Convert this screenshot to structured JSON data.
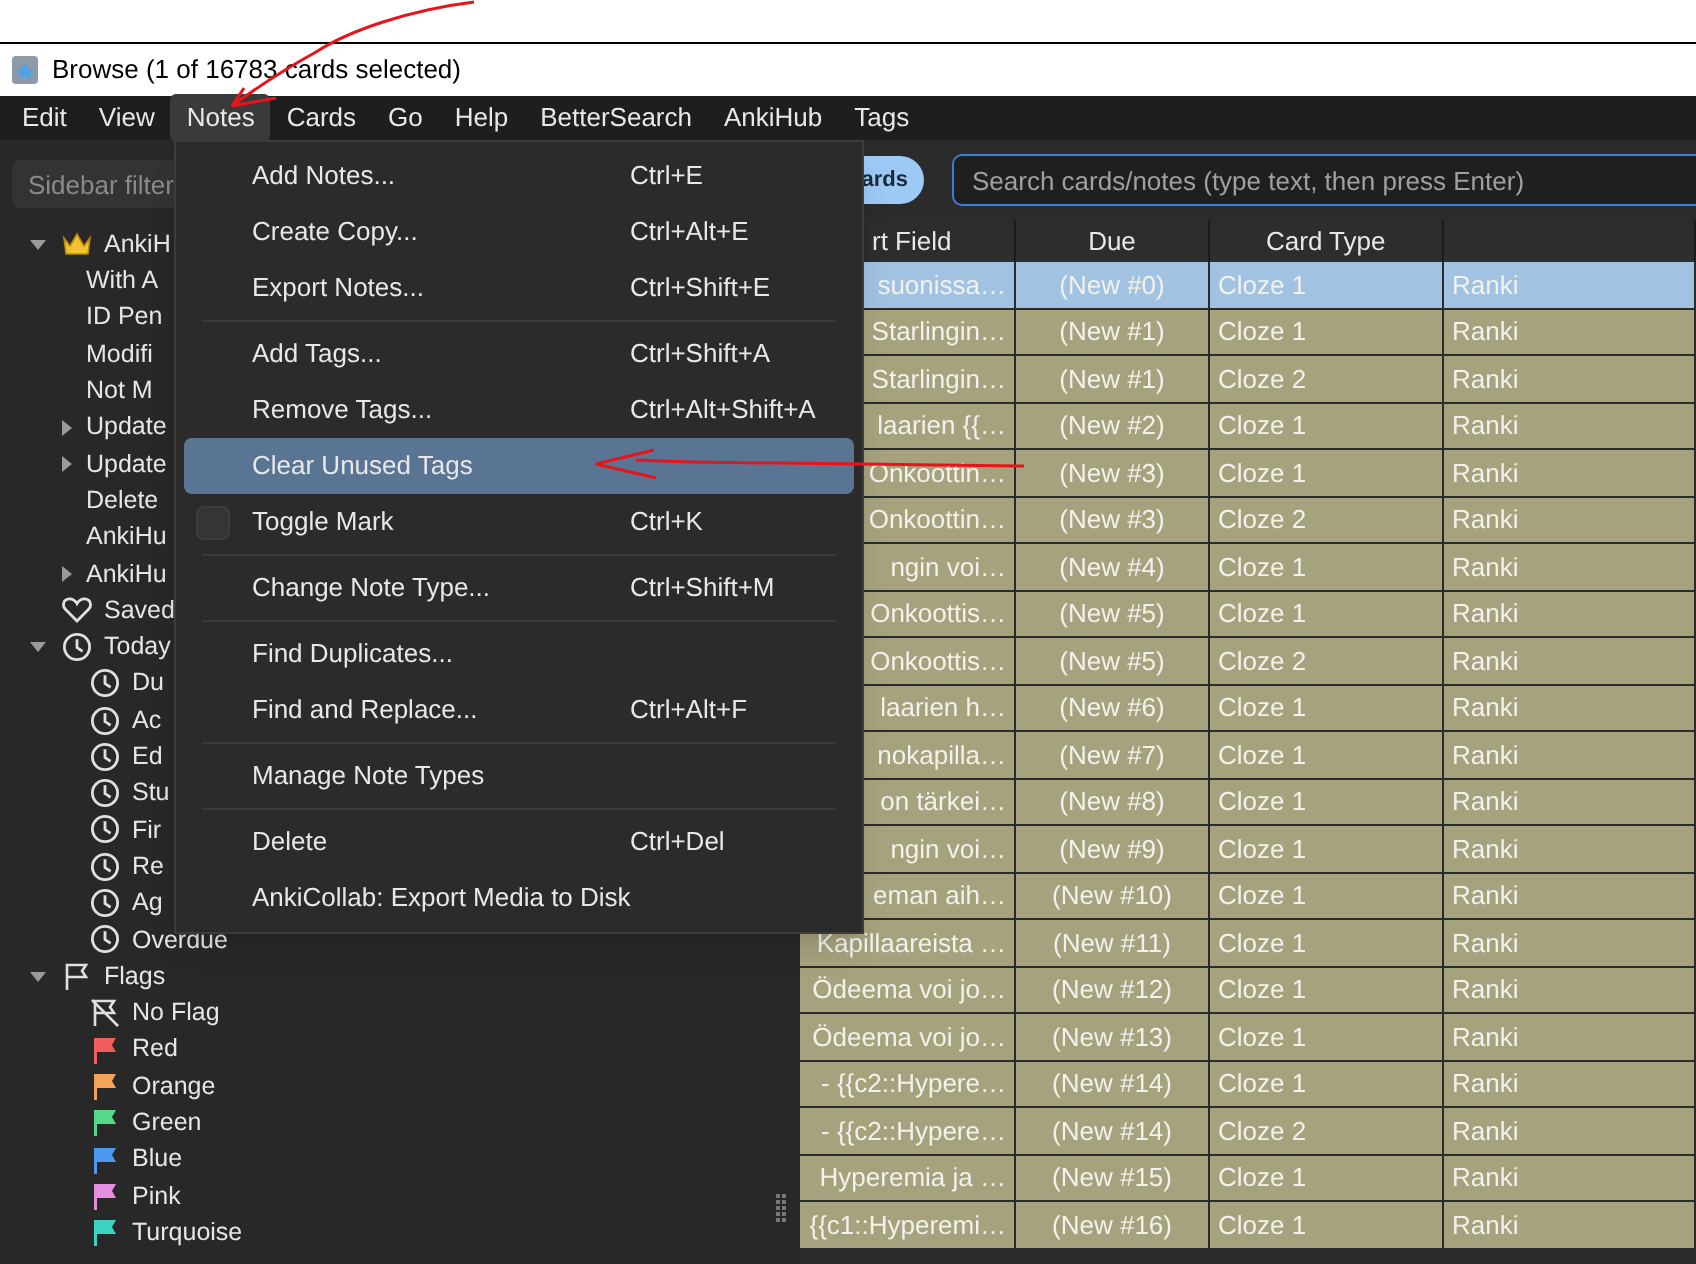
{
  "window": {
    "title": "Browse (1 of 16783 cards selected)"
  },
  "menubar": [
    {
      "label": "Edit",
      "selected": false
    },
    {
      "label": "View",
      "selected": false
    },
    {
      "label": "Notes",
      "selected": true
    },
    {
      "label": "Cards",
      "selected": false
    },
    {
      "label": "Go",
      "selected": false
    },
    {
      "label": "Help",
      "selected": false
    },
    {
      "label": "BetterSearch",
      "selected": false
    },
    {
      "label": "AnkiHub",
      "selected": false
    },
    {
      "label": "Tags",
      "selected": false
    }
  ],
  "notes_menu": [
    {
      "kind": "action",
      "label": "Add Notes...",
      "shortcut": "Ctrl+E",
      "selected": false
    },
    {
      "kind": "action",
      "label": "Create Copy...",
      "shortcut": "Ctrl+Alt+E",
      "selected": false
    },
    {
      "kind": "action",
      "label": "Export Notes...",
      "shortcut": "Ctrl+Shift+E",
      "selected": false
    },
    {
      "kind": "separator"
    },
    {
      "kind": "action",
      "label": "Add Tags...",
      "shortcut": "Ctrl+Shift+A",
      "selected": false
    },
    {
      "kind": "action",
      "label": "Remove Tags...",
      "shortcut": "Ctrl+Alt+Shift+A",
      "selected": false
    },
    {
      "kind": "action",
      "label": "Clear Unused Tags",
      "selected": true
    },
    {
      "kind": "check",
      "label": "Toggle Mark",
      "shortcut": "Ctrl+K",
      "checked": false,
      "selected": false
    },
    {
      "kind": "separator"
    },
    {
      "kind": "action",
      "label": "Change Note Type...",
      "shortcut": "Ctrl+Shift+M",
      "selected": false
    },
    {
      "kind": "separator"
    },
    {
      "kind": "action",
      "label": "Find Duplicates...",
      "selected": false
    },
    {
      "kind": "action",
      "label": "Find and Replace...",
      "shortcut": "Ctrl+Alt+F",
      "selected": false
    },
    {
      "kind": "separator"
    },
    {
      "kind": "action",
      "label": "Manage Note Types",
      "selected": false
    },
    {
      "kind": "separator"
    },
    {
      "kind": "action",
      "label": "Delete",
      "shortcut": "Ctrl+Del",
      "selected": false
    },
    {
      "kind": "action",
      "label": "AnkiCollab: Export Media to Disk",
      "selected": false
    }
  ],
  "sidebar": {
    "filter": {
      "placeholder": "Sidebar filter"
    },
    "items": [
      {
        "kind": "crown",
        "label": "AnkiH",
        "expanded": true,
        "children": [
          {
            "kind": "plain",
            "label": "With A"
          },
          {
            "kind": "plain",
            "label": "ID Pen"
          },
          {
            "kind": "plain",
            "label": "Modifi"
          },
          {
            "kind": "plain",
            "label": "Not M"
          },
          {
            "kind": "plain",
            "label": "Update",
            "expanded": false
          },
          {
            "kind": "plain",
            "label": "Update",
            "expanded": false
          },
          {
            "kind": "plain",
            "label": "Delete"
          },
          {
            "kind": "plain",
            "label": "AnkiHu"
          },
          {
            "kind": "plain",
            "label": "AnkiHu",
            "expanded": false
          }
        ]
      },
      {
        "kind": "heart",
        "label": "Saved"
      },
      {
        "kind": "clock",
        "label": "Today",
        "expanded": true,
        "children": [
          {
            "kind": "clock",
            "label": "Du"
          },
          {
            "kind": "clock",
            "label": "Ac"
          },
          {
            "kind": "clock",
            "label": "Ed"
          },
          {
            "kind": "clock",
            "label": "Stu"
          },
          {
            "kind": "clock",
            "label": "Fir"
          },
          {
            "kind": "clock",
            "label": "Re"
          },
          {
            "kind": "clock",
            "label": "Ag"
          },
          {
            "kind": "clock",
            "label": "Overdue"
          }
        ]
      },
      {
        "kind": "flag",
        "label": "Flags",
        "expanded": true,
        "children": [
          {
            "kind": "noflag",
            "label": "No Flag"
          },
          {
            "kind": "flag",
            "label": "Red",
            "color": "#ef5d5d"
          },
          {
            "kind": "flag",
            "label": "Orange",
            "color": "#f4a35a"
          },
          {
            "kind": "flag",
            "label": "Green",
            "color": "#55d88a"
          },
          {
            "kind": "flag",
            "label": "Blue",
            "color": "#4c9af0"
          },
          {
            "kind": "flag",
            "label": "Pink",
            "color": "#e58fe0"
          },
          {
            "kind": "flag",
            "label": "Turquoise",
            "color": "#3ed2c0"
          }
        ]
      }
    ]
  },
  "search": {
    "toggle": "ards",
    "placeholder": "Search cards/notes (type text, then press Enter)"
  },
  "table": {
    "columns": [
      "rt Field",
      "Due",
      "Card Type"
    ],
    "rows": [
      {
        "cells": [
          "suonissa…",
          "(New #0)",
          "Cloze 1",
          "Ranki"
        ],
        "selected": true
      },
      {
        "cells": [
          "Starlingin…",
          "(New #1)",
          "Cloze 1",
          "Ranki"
        ],
        "selected": false
      },
      {
        "cells": [
          "Starlingin…",
          "(New #1)",
          "Cloze 2",
          "Ranki"
        ],
        "selected": false
      },
      {
        "cells": [
          "laarien {{…",
          "(New #2)",
          "Cloze 1",
          "Ranki"
        ],
        "selected": false
      },
      {
        "cells": [
          "Onkoottin…",
          "(New #3)",
          "Cloze 1",
          "Ranki"
        ],
        "selected": false
      },
      {
        "cells": [
          "Onkoottin…",
          "(New #3)",
          "Cloze 2",
          "Ranki"
        ],
        "selected": false
      },
      {
        "cells": [
          "ngin voi…",
          "(New #4)",
          "Cloze 1",
          "Ranki"
        ],
        "selected": false
      },
      {
        "cells": [
          "Onkoottis…",
          "(New #5)",
          "Cloze 1",
          "Ranki"
        ],
        "selected": false
      },
      {
        "cells": [
          "Onkoottis…",
          "(New #5)",
          "Cloze 2",
          "Ranki"
        ],
        "selected": false
      },
      {
        "cells": [
          "laarien h…",
          "(New #6)",
          "Cloze 1",
          "Ranki"
        ],
        "selected": false
      },
      {
        "cells": [
          "nokapilla…",
          "(New #7)",
          "Cloze 1",
          "Ranki"
        ],
        "selected": false
      },
      {
        "cells": [
          "on tärkei…",
          "(New #8)",
          "Cloze 1",
          "Ranki"
        ],
        "selected": false
      },
      {
        "cells": [
          "ngin voi…",
          "(New #9)",
          "Cloze 1",
          "Ranki"
        ],
        "selected": false
      },
      {
        "cells": [
          "eman aih…",
          "(New #10)",
          "Cloze 1",
          "Ranki"
        ],
        "selected": false
      },
      {
        "cells": [
          "Kapillaareista …",
          "(New #11)",
          "Cloze 1",
          "Ranki"
        ],
        "selected": false
      },
      {
        "cells": [
          "Ödeema voi jo…",
          "(New #12)",
          "Cloze 1",
          "Ranki"
        ],
        "selected": false
      },
      {
        "cells": [
          "Ödeema voi jo…",
          "(New #13)",
          "Cloze 1",
          "Ranki"
        ],
        "selected": false
      },
      {
        "cells": [
          "- {{c2::Hypere…",
          "(New #14)",
          "Cloze 1",
          "Ranki"
        ],
        "selected": false
      },
      {
        "cells": [
          "- {{c2::Hypere…",
          "(New #14)",
          "Cloze 2",
          "Ranki"
        ],
        "selected": false
      },
      {
        "cells": [
          "Hyperemia ja …",
          "(New #15)",
          "Cloze 1",
          "Ranki"
        ],
        "selected": false
      },
      {
        "cells": [
          "{{c1::Hyperemi…",
          "(New #16)",
          "Cloze 1",
          "Ranki"
        ],
        "selected": false
      }
    ]
  }
}
